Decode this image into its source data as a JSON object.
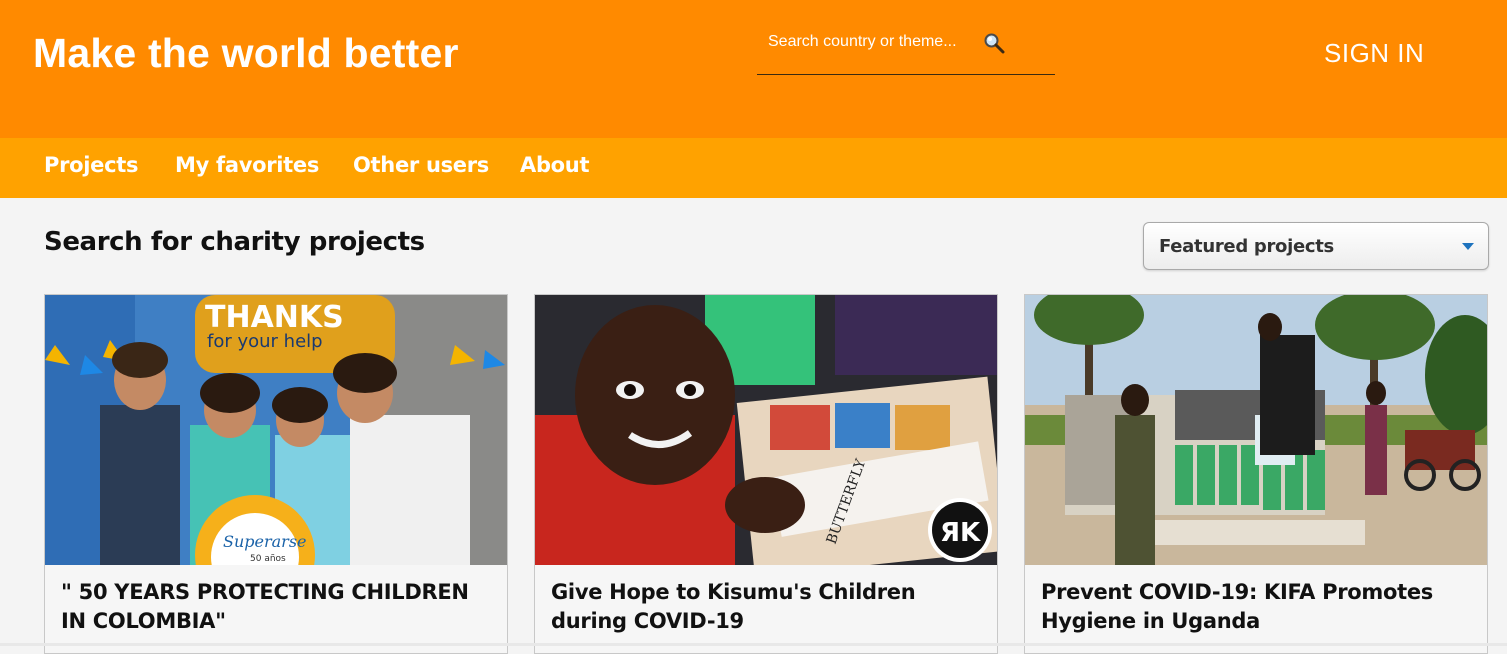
{
  "header": {
    "brand": "Make the world better",
    "search_placeholder": "Search country or theme...",
    "signin_label": "SIGN IN",
    "color": "#ff8a00"
  },
  "nav": {
    "color": "#ffa200",
    "items": [
      {
        "label": "Projects"
      },
      {
        "label": "My favorites"
      },
      {
        "label": "Other users"
      },
      {
        "label": "About"
      }
    ]
  },
  "main": {
    "title": "Search for charity projects",
    "sort": {
      "selected": "Featured projects"
    }
  },
  "projects": [
    {
      "title": "\" 50 YEARS PROTECTING CHILDREN IN COLOMBIA\"",
      "image": "children-thanks-photo",
      "image_text": [
        "THANKS",
        "for your help",
        "Superarse",
        "50 años"
      ]
    },
    {
      "title": "Give Hope to Kisumu's Children during COVID-19",
      "image": "child-drawing-photo",
      "image_text": [
        "BUTTERFLY"
      ]
    },
    {
      "title": "Prevent COVID-19: KIFA Promotes Hygiene in Uganda",
      "image": "hygiene-supplies-truck-photo"
    }
  ]
}
